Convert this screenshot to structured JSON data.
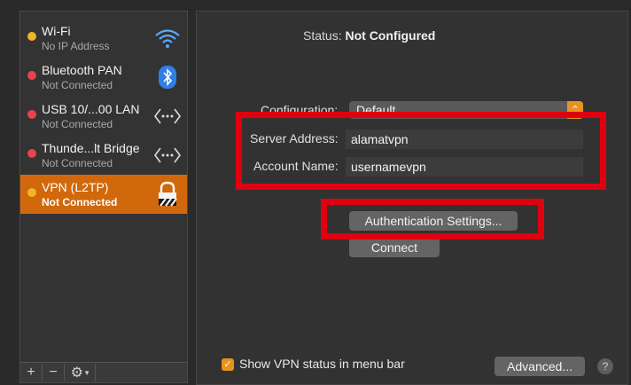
{
  "services": [
    {
      "name": "Wi-Fi",
      "status": "No IP Address",
      "dot_color": "#f0b429",
      "icon": "wifi-icon"
    },
    {
      "name": "Bluetooth PAN",
      "status": "Not Connected",
      "dot_color": "#e8434e",
      "icon": "bluetooth-icon"
    },
    {
      "name": "USB 10/...00 LAN",
      "status": "Not Connected",
      "dot_color": "#e8434e",
      "icon": "ethernet-arrows-icon"
    },
    {
      "name": "Thunde...lt Bridge",
      "status": "Not Connected",
      "dot_color": "#e8434e",
      "icon": "ethernet-arrows-icon"
    },
    {
      "name": "VPN (L2TP)",
      "status": "Not Connected",
      "dot_color": "#f0b429",
      "icon": "vpn-lock-icon",
      "selected": true
    }
  ],
  "footer": {
    "add": "+",
    "remove": "−",
    "gear": "⚙"
  },
  "detail": {
    "status_label": "Status:",
    "status_value": "Not Configured",
    "configuration_label": "Configuration:",
    "configuration_value": "Default",
    "server_label": "Server Address:",
    "server_value": "alamatvpn",
    "account_label": "Account Name:",
    "account_value": "usernamevpn",
    "auth_button": "Authentication Settings...",
    "connect_button": "Connect",
    "show_status_label": "Show VPN status in menu bar",
    "show_status_checked": true,
    "advanced_button": "Advanced...",
    "help": "?"
  },
  "colors": {
    "accent": "#e8931d",
    "selection": "#d1690c",
    "highlight": "#e0000f"
  }
}
